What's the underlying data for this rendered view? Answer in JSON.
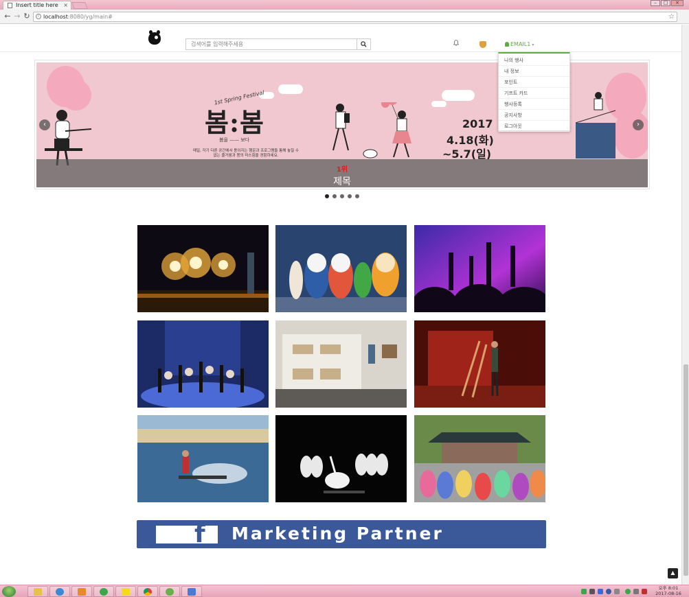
{
  "browser": {
    "tab_title": "Insert title here",
    "tab_close": "×",
    "url_host": "localhost",
    "url_rest": ":8080/yg/main#"
  },
  "header": {
    "search_placeholder": "검색어를 입력해주세용",
    "user_label": "EMAIL1",
    "user_caret": "▾"
  },
  "dropdown": {
    "items": [
      "나의 행사",
      "내 정보",
      "포인트",
      "기프트 카드",
      "행사등록",
      "공지사항",
      "로그아웃"
    ]
  },
  "carousel": {
    "festival_label": "1st Spring Festival",
    "title": "봄:봄",
    "subtitle": "봄을 —— 보다",
    "description": "매일, 각기 다른 공간에서 용이지는 행운과 프로그램들 통해 놓칠 수 없는 즐거움과 봄의 마스힘을 경험하세요.",
    "year": "2017",
    "date_start": "4.18(화)",
    "date_end": "~5.7(일)",
    "rank": "1위",
    "caption": "제목",
    "prev_arrow": "‹",
    "next_arrow": "›",
    "slide_count": 5,
    "active_slide": 1
  },
  "gallery": {
    "items": [
      {
        "name": "fireworks-image"
      },
      {
        "name": "kids-characters-image"
      },
      {
        "name": "concert-crowd-image"
      },
      {
        "name": "ballet-performance-image"
      },
      {
        "name": "art-exhibition-image"
      },
      {
        "name": "theater-stage-image"
      },
      {
        "name": "water-sports-image"
      },
      {
        "name": "ballet-dancer-image"
      },
      {
        "name": "hanbok-dance-image"
      }
    ]
  },
  "marketing": {
    "logo_letter": "f",
    "label": "Marketing Partner"
  },
  "to_top": "▲",
  "taskbar": {
    "clock_time": "오후 8:01",
    "clock_date": "2017-08-16"
  }
}
